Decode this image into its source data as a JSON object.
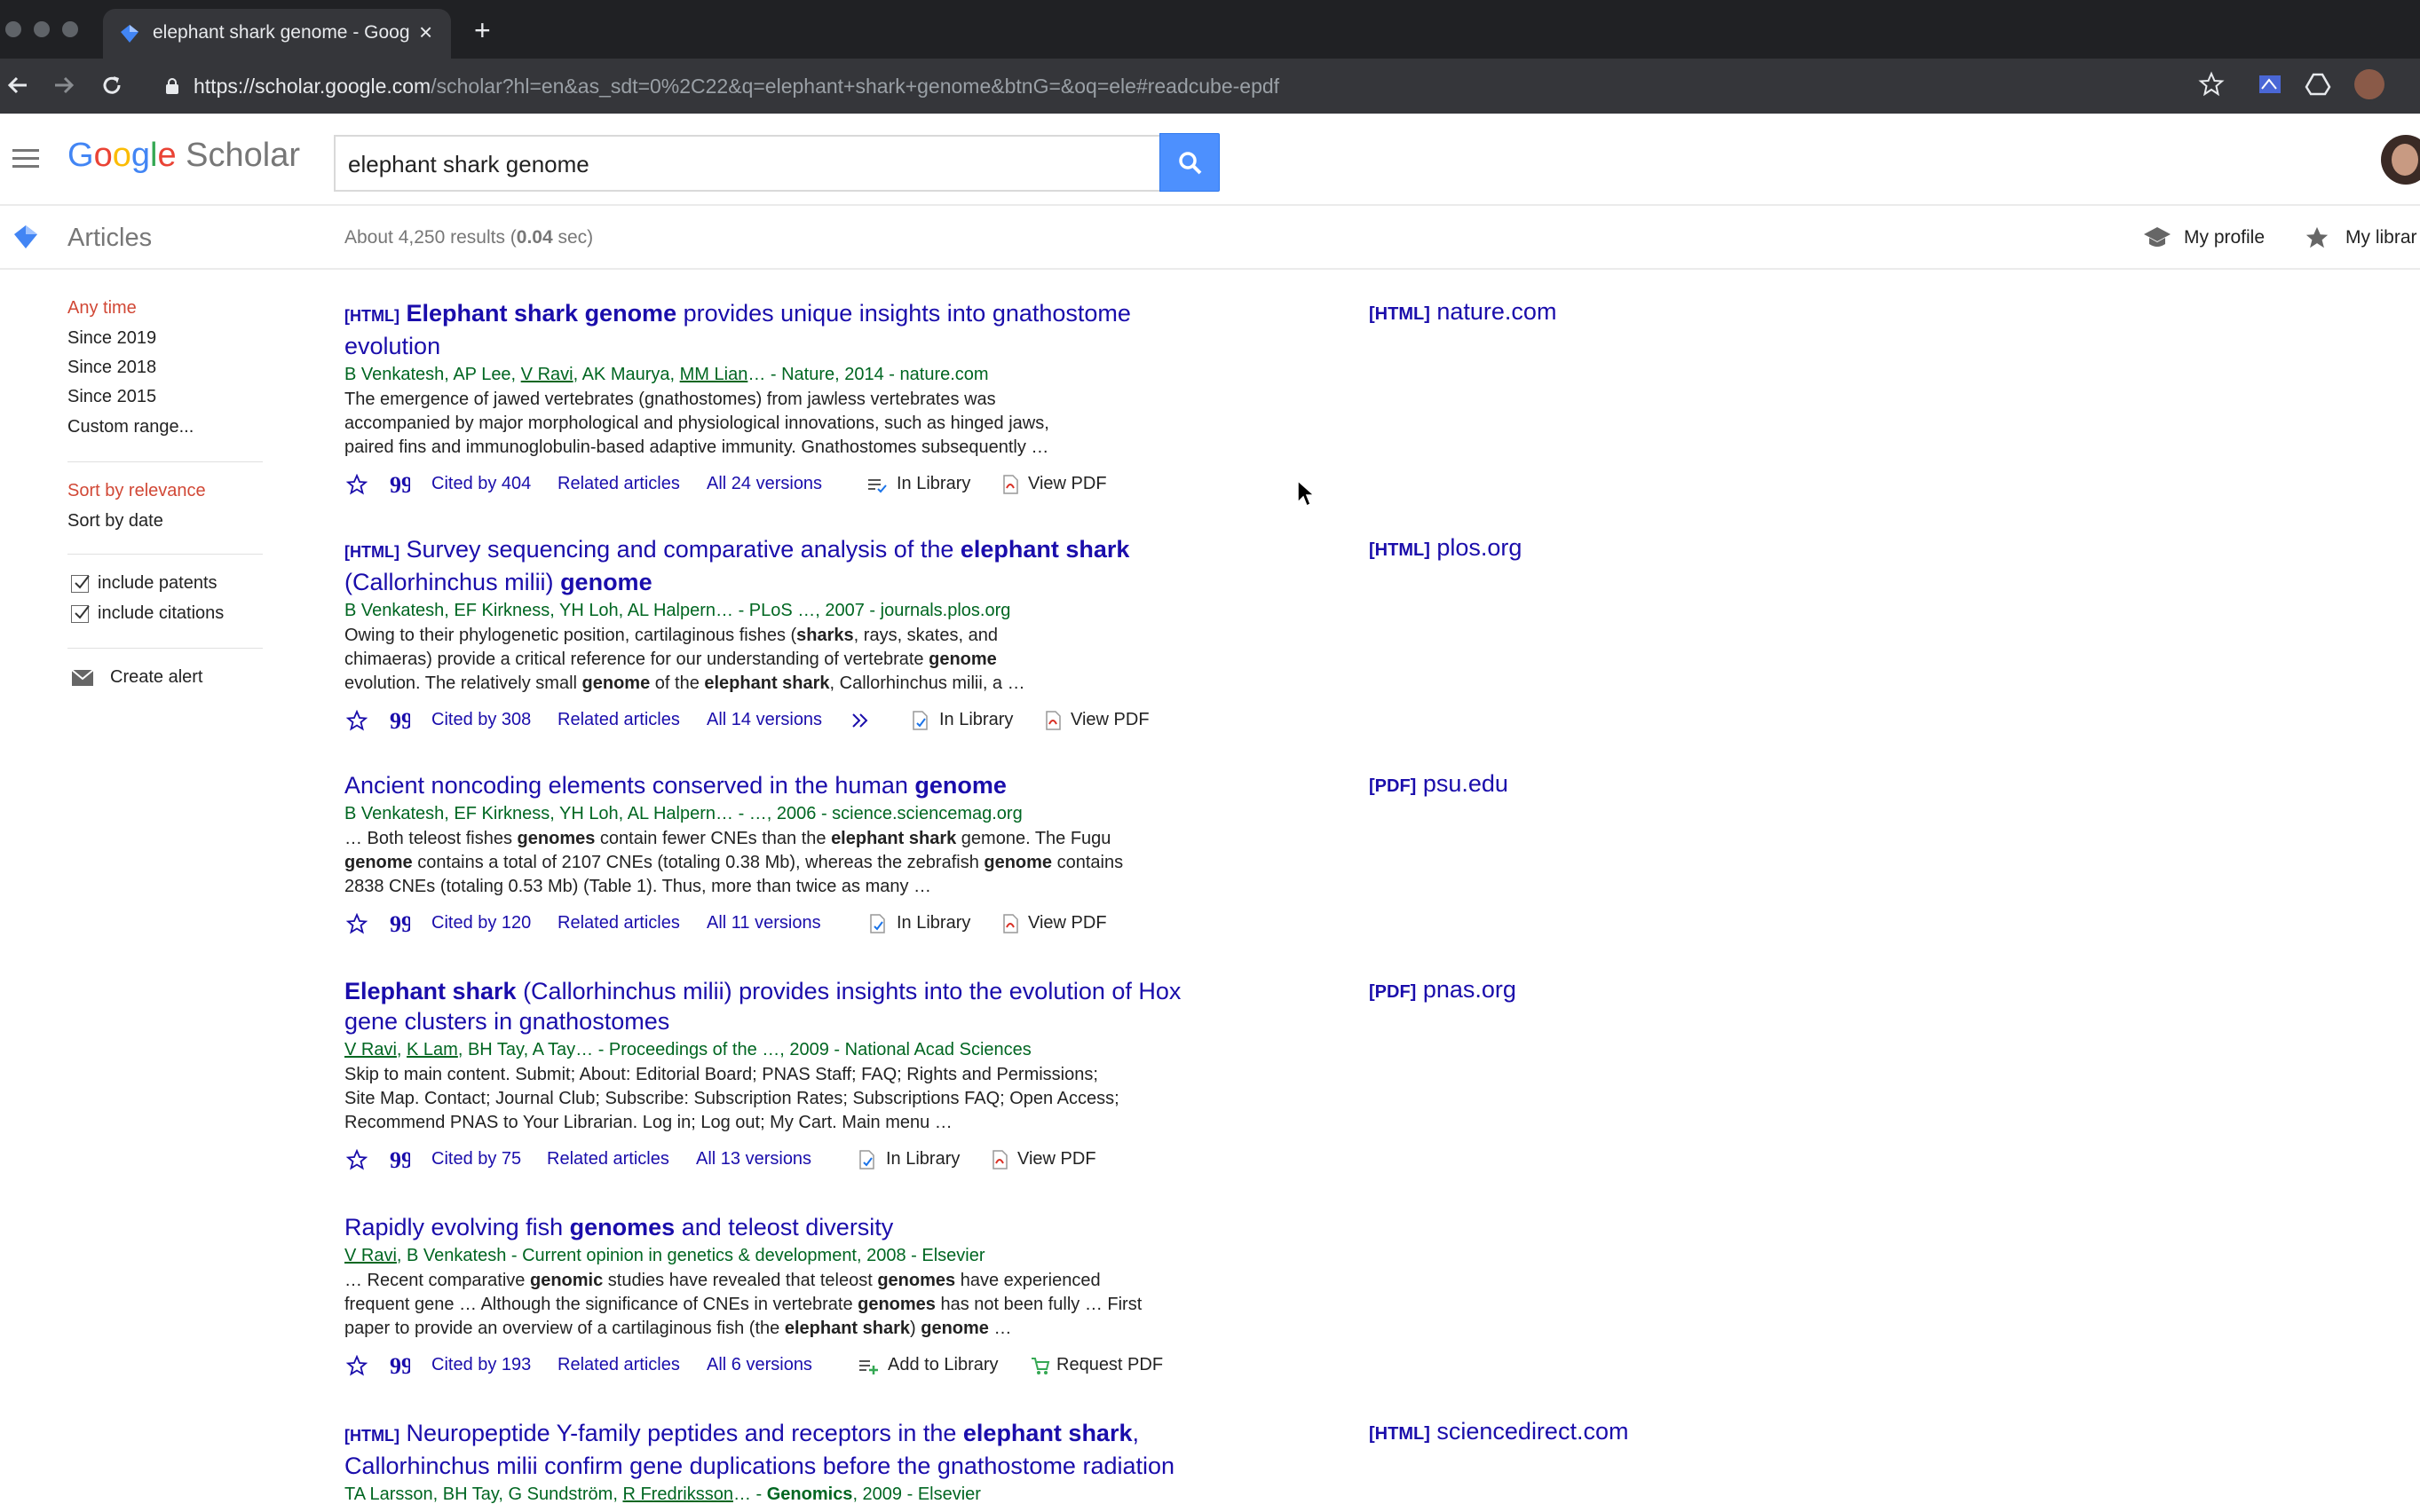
{
  "browser": {
    "tab_title": "elephant shark genome - Goog",
    "url_host": "https://scholar.google.com",
    "url_path": "/scholar?hl=en&as_sdt=0%2C22&q=elephant+shark+genome&btnG=&oq=ele#readcube-epdf",
    "new_tab_glyph": "+",
    "close_glyph": "×"
  },
  "header": {
    "logo_google": [
      "G",
      "o",
      "o",
      "g",
      "l",
      "e"
    ],
    "logo_scholar": "Scholar",
    "search_value": "elephant shark genome"
  },
  "subheader": {
    "articles": "Articles",
    "results_prefix": "About 4,250 results (",
    "results_time": "0.04",
    "results_suffix": " sec)",
    "my_profile": "My profile",
    "my_library": "My librar"
  },
  "sidebar": {
    "time": [
      "Any time",
      "Since 2019",
      "Since 2018",
      "Since 2015",
      "Custom range..."
    ],
    "sort": [
      "Sort by relevance",
      "Sort by date"
    ],
    "include_patents": "include patents",
    "include_citations": "include citations",
    "create_alert": "Create alert"
  },
  "results": [
    {
      "tag": "[HTML]",
      "title_html": "<b>Elephant shark genome</b> provides unique insights into gnathostome evolution",
      "authors_html": "B Venkatesh, AP Lee, <u>V Ravi</u>, AK Maurya, <u>MM Lian</u>… - Nature, 2014 - nature.com",
      "snippet_html": "The emergence of jawed vertebrates (gnathostomes) from jawless vertebrates was<br>accompanied by major morphological and physiological innovations, such as hinged jaws,<br>paired fins and immunoglobulin-based adaptive immunity. Gnathostomes subsequently …",
      "cited": "Cited by 404",
      "related": "Related articles",
      "versions": "All 24 versions",
      "library": "In Library",
      "pdf": "View PDF",
      "side_tag": "[HTML]",
      "side_host": "nature.com"
    },
    {
      "tag": "[HTML]",
      "title_html": "Survey sequencing and comparative analysis of the <b>elephant shark</b><br>(Callorhinchus milii) <b>genome</b>",
      "authors_html": "B Venkatesh, EF Kirkness, YH Loh, AL Halpern… - PLoS …, 2007 - journals.plos.org",
      "snippet_html": "Owing to their phylogenetic position, cartilaginous fishes (<b>sharks</b>, rays, skates, and<br>chimaeras) provide a critical reference for our understanding of vertebrate <b>genome</b><br>evolution. The relatively small <b>genome</b> of the <b>elephant shark</b>, Callorhinchus milii, a …",
      "cited": "Cited by 308",
      "related": "Related articles",
      "versions": "All 14 versions",
      "library": "In Library",
      "pdf": "View PDF",
      "side_tag": "[HTML]",
      "side_host": "plos.org"
    },
    {
      "tag": "",
      "title_html": "Ancient noncoding elements conserved in the human <b>genome</b>",
      "authors_html": "B Venkatesh, EF Kirkness, YH Loh, AL Halpern… - …, 2006 - science.sciencemag.org",
      "snippet_html": "… Both teleost fishes <b>genomes</b> contain fewer CNEs than the <b>elephant shark</b> gemone. The Fugu<br><b>genome</b> contains a total of 2107 CNEs (totaling 0.38 Mb), whereas the zebrafish <b>genome</b> contains<br>2838 CNEs (totaling 0.53 Mb) (Table 1). Thus, more than twice as many …",
      "cited": "Cited by 120",
      "related": "Related articles",
      "versions": "All 11 versions",
      "library": "In Library",
      "pdf": "View PDF",
      "side_tag": "[PDF]",
      "side_host": "psu.edu"
    },
    {
      "tag": "",
      "title_html": "<b>Elephant shark</b> (Callorhinchus milii) provides insights into the evolution of Hox<br>gene clusters in gnathostomes",
      "authors_html": "<u>V Ravi</u>, <u>K Lam</u>, BH Tay, A Tay… - Proceedings of the …, 2009 - National Acad Sciences",
      "snippet_html": "Skip to main content. Submit; About: Editorial Board; PNAS Staff; FAQ; Rights and Permissions;<br>Site Map. Contact; Journal Club; Subscribe: Subscription Rates; Subscriptions FAQ; Open Access;<br>Recommend PNAS to Your Librarian. Log in; Log out; My Cart. Main menu …",
      "cited": "Cited by 75",
      "related": "Related articles",
      "versions": "All 13 versions",
      "library": "In Library",
      "pdf": "View PDF",
      "side_tag": "[PDF]",
      "side_host": "pnas.org"
    },
    {
      "tag": "",
      "title_html": "Rapidly evolving fish <b>genomes</b> and teleost diversity",
      "authors_html": "<u>V Ravi</u>, B Venkatesh - Current opinion in genetics &amp; development, 2008 - Elsevier",
      "snippet_html": "… Recent comparative <b>genomic</b> studies have revealed that teleost <b>genomes</b> have experienced<br>frequent gene … Although the significance of CNEs in vertebrate <b>genomes</b> has not been fully … First<br>paper to provide an overview of a cartilaginous fish (the <b>elephant shark</b>) <b>genome</b> …",
      "cited": "Cited by 193",
      "related": "Related articles",
      "versions": "All 6 versions",
      "library": "Add to Library",
      "pdf": "Request PDF",
      "side_tag": "",
      "side_host": ""
    },
    {
      "tag": "[HTML]",
      "title_html": "Neuropeptide Y-family peptides and receptors in the <b>elephant shark</b>,<br>Callorhinchus milii confirm gene duplications before the gnathostome radiation",
      "authors_html": "TA Larsson, BH Tay, G Sundström, <u>R Fredriksson</u>… - <b>Genomics</b>, 2009 - Elsevier",
      "snippet_html": "",
      "side_tag": "[HTML]",
      "side_host": "sciencedirect.com"
    }
  ],
  "colors": {
    "link": "#1a0dab",
    "authors": "#006621",
    "red": "#d14836",
    "search_button": "#4d90fe"
  }
}
